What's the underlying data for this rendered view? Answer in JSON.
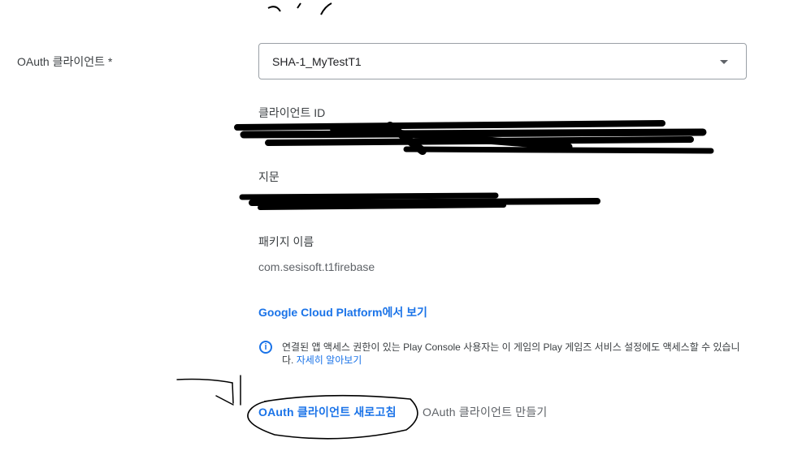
{
  "oauth": {
    "field_label": "OAuth 클라이언트  *",
    "selected_value": "SHA-1_MyTestT1",
    "client_id_label": "클라이언트 ID",
    "client_id_value": "",
    "fingerprint_label": "지문",
    "fingerprint_value": "",
    "package_label": "패키지 이름",
    "package_value": "com.sesisoft.t1firebase",
    "gcp_link": "Google Cloud Platform에서 보기",
    "info_text": "연결된 앱 액세스 권한이 있는 Play Console 사용자는 이 게임의 Play 게임즈 서비스 설정에도 액세스할 수 있습니다.",
    "learn_more": "자세히 알아보기",
    "refresh_button": "OAuth 클라이언트 새로고침",
    "create_button": "OAuth 클라이언트 만들기"
  },
  "colors": {
    "link": "#1a73e8",
    "text": "#3c4043",
    "secondary": "#5f6368",
    "border": "#9aa0a6",
    "redaction": "#000000"
  },
  "icons": [
    "info-icon",
    "chevron-down-icon"
  ]
}
